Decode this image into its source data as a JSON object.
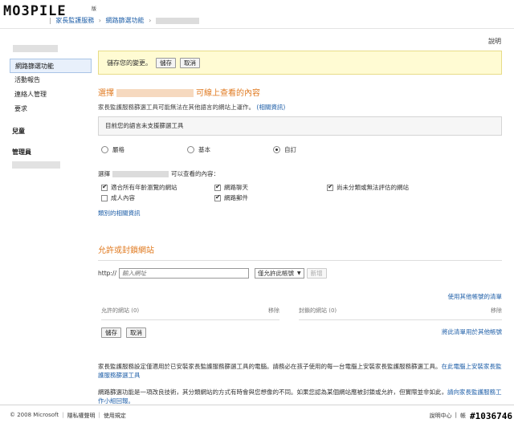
{
  "header": {
    "logo_text": "MO3PILE",
    "logo_tag": "版",
    "breadcrumbs": [
      "家長監護服務",
      "網路篩選功能"
    ]
  },
  "help": "說明",
  "sidebar": {
    "items": [
      {
        "label": "網路篩選功能",
        "active": true
      },
      {
        "label": "活動報告"
      },
      {
        "label": "連絡人管理"
      },
      {
        "label": "要求"
      }
    ],
    "group_kids": "兒童",
    "group_admin": "管理員"
  },
  "savebar": {
    "message": "儲存您的變更。",
    "save": "儲存",
    "cancel": "取消"
  },
  "filter": {
    "title_prefix": "選擇",
    "title_suffix": "可線上查看的內容",
    "desc": "家長監護服務篩選工具可能無法在其他語言的網站上運作。",
    "desc_link": "(相關資訊)",
    "info": "目前您的語言未支援篩選工具",
    "radios": [
      {
        "label": "嚴格",
        "checked": false
      },
      {
        "label": "基本",
        "checked": false
      },
      {
        "label": "自訂",
        "checked": true
      }
    ],
    "view_prefix": "選擇",
    "view_suffix": "可以查看的內容：",
    "checks": [
      {
        "label": "適合所有年齡瀏覽的網站",
        "checked": true
      },
      {
        "label": "網路聊天",
        "checked": true
      },
      {
        "label": "尚未分類或無法評估的網站",
        "checked": true
      },
      {
        "label": "成人內容",
        "checked": false
      },
      {
        "label": "網路郵件",
        "checked": true
      }
    ],
    "more_link": "類別的相關資訊"
  },
  "block": {
    "title": "允許或封鎖網站",
    "url_prefix": "http://",
    "url_placeholder": "輸入網址",
    "select_value": "僅允許此帳號",
    "add": "新增",
    "apply_other": "使用其他帳號的清單",
    "allowed_header": "允許的網站 (0)",
    "blocked_header": "封鎖的網站 (0)",
    "remove": "移除",
    "save": "儲存",
    "cancel": "取消",
    "apply_list": "將此清單用於其他帳號"
  },
  "notes": {
    "p1": "家長監護服務設定僅適用於已安裝家長監護服務篩選工具的電腦。請務必在孩子使用的每一台電腦上安裝家長監護服務篩選工具。",
    "p1_link": "在此電腦上安裝家長監護服務篩選工具",
    "p2": "網路篩選功能是一項改良技術，其分類網站的方式有時會與您想像的不同。如果您認為某個網站應被封鎖或允許，但實際並非如此，",
    "p2_link": "請向家長監護服務工作小組回報。"
  },
  "footer": {
    "copyright": "© 2008 Microsoft",
    "privacy": "隱私權聲明",
    "terms": "使用規定",
    "help_center": "說明中心",
    "feedback": "帳"
  },
  "watermark": "#1036746"
}
